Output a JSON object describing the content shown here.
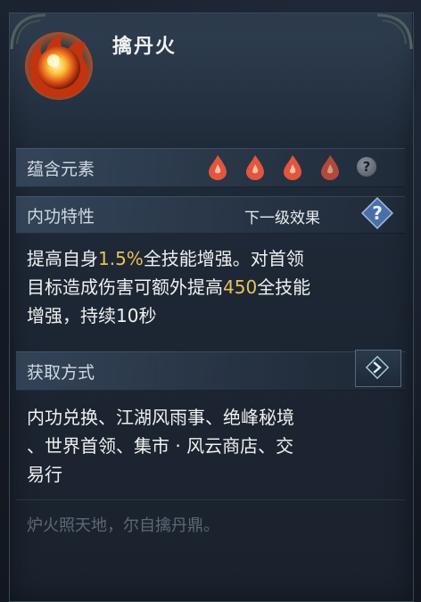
{
  "item": {
    "title": "擒丹火",
    "flavor_text": "炉火照天地，尔自擒丹鼎。"
  },
  "sections": {
    "elements": {
      "label": "蕴含元素",
      "icons": [
        "fire-drop-icon",
        "fire-drop-icon",
        "fire-drop-icon",
        "fire-drop-icon-dim",
        "help-icon"
      ],
      "help_glyph": "?"
    },
    "internal": {
      "label": "内功特性",
      "next_level_label": "下一级效果",
      "help_glyph": "?",
      "description": {
        "line1_pre": "提高自身",
        "line1_value": "1.5%",
        "line1_post": "全技能增强。对首领",
        "line2_pre": "目标造成伤害可额外提高",
        "line2_value": "450",
        "line2_post": "全技能",
        "line3": "增强，持续10秒"
      }
    },
    "acquire": {
      "label": "获取方式",
      "line1": "内功兑换、江湖风雨事、绝峰秘境",
      "line2": "、世界首领、集市 · 风云商店、交",
      "line3": "易行"
    }
  },
  "colors": {
    "highlight": "#e8c25a",
    "body_text": "#f0f0f0",
    "label_text": "#cfd8e2",
    "flavor_text": "#5e6874"
  }
}
